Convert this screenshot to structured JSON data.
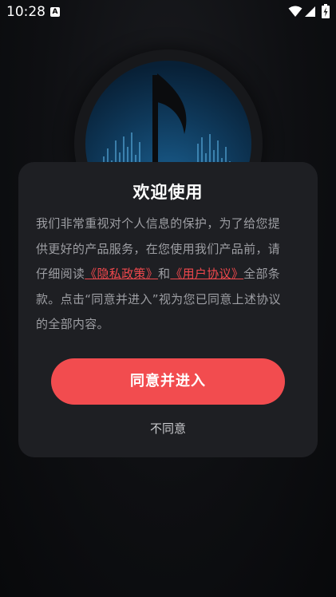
{
  "status_bar": {
    "time": "10:28",
    "notification_icon": "A",
    "icons": [
      "wifi-icon",
      "signal-icon",
      "battery-icon"
    ]
  },
  "logo": {
    "icon": "music-note-icon"
  },
  "dialog": {
    "title": "欢迎使用",
    "body": {
      "line1": "我们非常重视对个人信息的保护，为了给您提",
      "line2": "供更好的产品服务，在您使用我们产品前，请",
      "line3_prefix": "仔细阅读",
      "privacy_link": "《隐私政策》",
      "line3_middle": "和",
      "user_agreement_link": "《用户协议》",
      "line3_suffix": "全部条",
      "line4": "款。点击“同意并进入”视为您已同意上述协议",
      "line5": "的全部内容。"
    },
    "agree_button": "同意并进入",
    "disagree_button": "不同意"
  },
  "colors": {
    "accent": "#f24c4f",
    "link": "#f0484d",
    "dialog_bg": "#1e1f23",
    "page_bg": "#0d0e11"
  }
}
